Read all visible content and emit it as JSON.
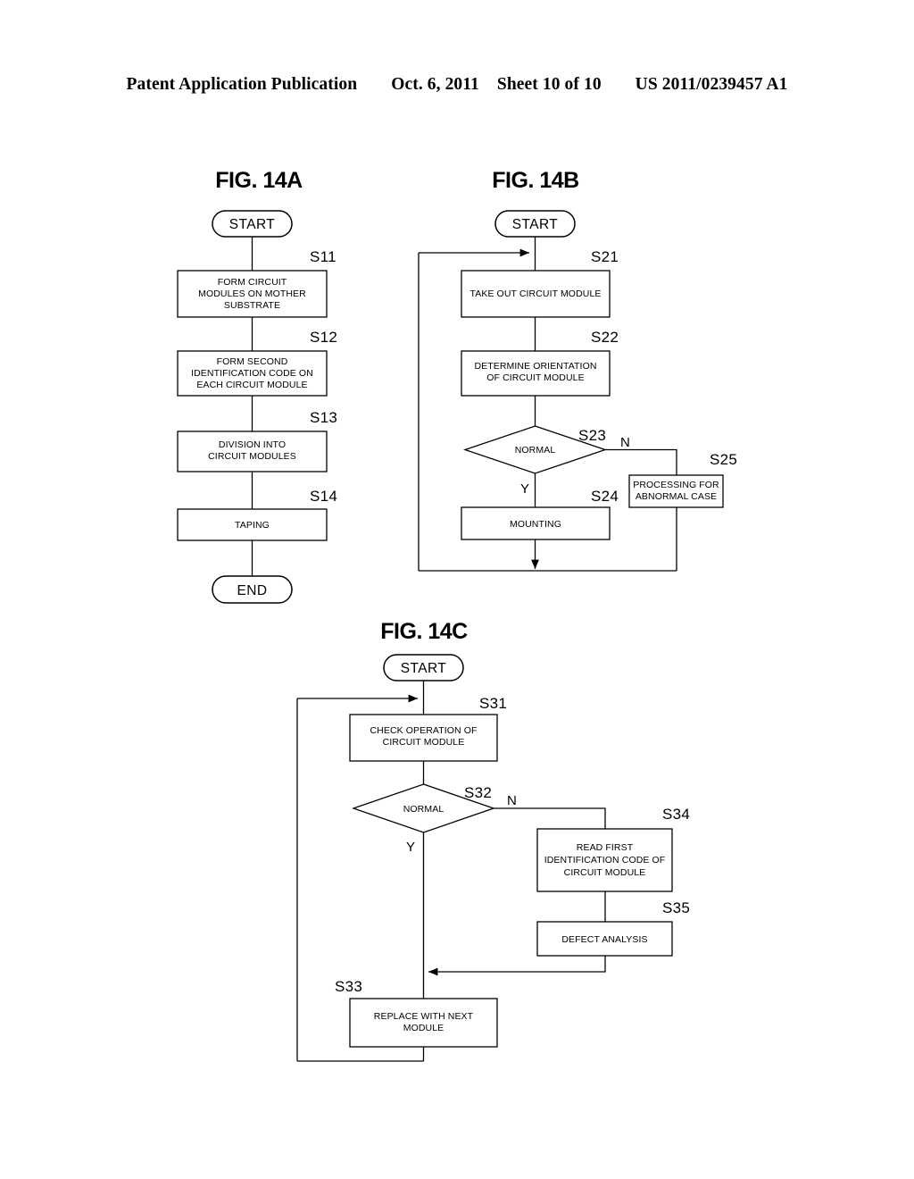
{
  "header": {
    "publication": "Patent Application Publication",
    "date": "Oct. 6, 2011",
    "sheet": "Sheet 10 of 10",
    "number": "US 2011/0239457 A1"
  },
  "figures": [
    {
      "id": "fig-14a",
      "title": "FIG. 14A",
      "start_label": "START",
      "end_label": "END",
      "steps": [
        {
          "tag": "S11",
          "text": [
            "FORM CIRCUIT",
            "MODULES ON MOTHER",
            "SUBSTRATE"
          ]
        },
        {
          "tag": "S12",
          "text": [
            "FORM SECOND",
            "IDENTIFICATION CODE ON",
            "EACH CIRCUIT MODULE"
          ]
        },
        {
          "tag": "S13",
          "text": [
            "DIVISION INTO",
            "CIRCUIT MODULES"
          ]
        },
        {
          "tag": "S14",
          "text": [
            "TAPING"
          ]
        }
      ]
    },
    {
      "id": "fig-14b",
      "title": "FIG. 14B",
      "start_label": "START",
      "steps": [
        {
          "tag": "S21",
          "text": [
            "TAKE OUT CIRCUIT MODULE"
          ]
        },
        {
          "tag": "S22",
          "text": [
            "DETERMINE ORIENTATION",
            "OF CIRCUIT MODULE"
          ]
        },
        {
          "tag": "S23",
          "text": [
            "NORMAL"
          ],
          "shape": "decision"
        },
        {
          "tag": "S24",
          "text": [
            "MOUNTING"
          ]
        },
        {
          "tag": "S25",
          "text": [
            "PROCESSING FOR",
            "ABNORMAL CASE"
          ]
        }
      ],
      "branch_yes": "Y",
      "branch_no": "N"
    },
    {
      "id": "fig-14c",
      "title": "FIG. 14C",
      "start_label": "START",
      "steps": [
        {
          "tag": "S31",
          "text": [
            "CHECK OPERATION OF",
            "CIRCUIT MODULE"
          ]
        },
        {
          "tag": "S32",
          "text": [
            "NORMAL"
          ],
          "shape": "decision"
        },
        {
          "tag": "S33",
          "text": [
            "REPLACE WITH NEXT",
            "MODULE"
          ]
        },
        {
          "tag": "S34",
          "text": [
            "READ FIRST",
            "IDENTIFICATION CODE OF",
            "CIRCUIT MODULE"
          ]
        },
        {
          "tag": "S35",
          "text": [
            "DEFECT ANALYSIS"
          ]
        }
      ],
      "branch_yes": "Y",
      "branch_no": "N"
    }
  ]
}
